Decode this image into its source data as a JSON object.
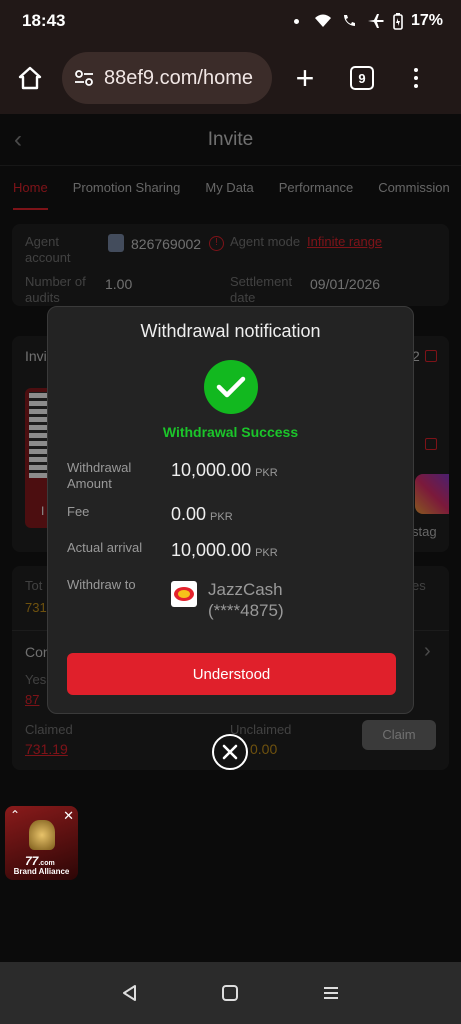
{
  "status_bar": {
    "time": "18:43",
    "battery": "17%"
  },
  "browser": {
    "url": "88ef9.com/home",
    "tab_count": "9"
  },
  "page": {
    "title": "Invite",
    "tabs": [
      "Home",
      "Promotion Sharing",
      "My Data",
      "Performance",
      "Commission"
    ],
    "agent_account_label": "Agent account",
    "agent_account_value": "826769002",
    "agent_mode_label": "Agent mode",
    "agent_mode_value": "Infinite range",
    "audits_label": "Number of audits",
    "audits_value": "1.00",
    "settlement_label": "Settlement date",
    "settlement_value": "09/01/2026",
    "invite_partial": "Invi",
    "copy_partial": "2",
    "total_partial": "Tot",
    "total_value_partial": "731",
    "total_right_partial": "es",
    "con_partial": "Con",
    "yes_partial": "Yes",
    "yes_value_partial": "87",
    "claimed_label": "Claimed",
    "claimed_value": "731.19",
    "unclaimed_label": "Unclaimed",
    "unclaimed_value": "0.00",
    "claim_button": "Claim",
    "insta_partial": "stag",
    "qr_partial": "I"
  },
  "modal": {
    "title": "Withdrawal notification",
    "status": "Withdrawal Success",
    "rows": [
      {
        "label": "Withdrawal Amount",
        "value": "10,000.00",
        "unit": "PKR"
      },
      {
        "label": "Fee",
        "value": "0.00",
        "unit": "PKR"
      },
      {
        "label": "Actual arrival",
        "value": "10,000.00",
        "unit": "PKR"
      }
    ],
    "withdraw_to_label": "Withdraw to",
    "withdraw_to_name": "JazzCash",
    "withdraw_to_account": "(****4875)",
    "button": "Understood"
  },
  "float_banner": {
    "brand": "77",
    "tagline": "Brand Alliance",
    "domain_suffix": ".com"
  },
  "colors": {
    "accent_red": "#e0202b",
    "success_green": "#12b81f"
  }
}
